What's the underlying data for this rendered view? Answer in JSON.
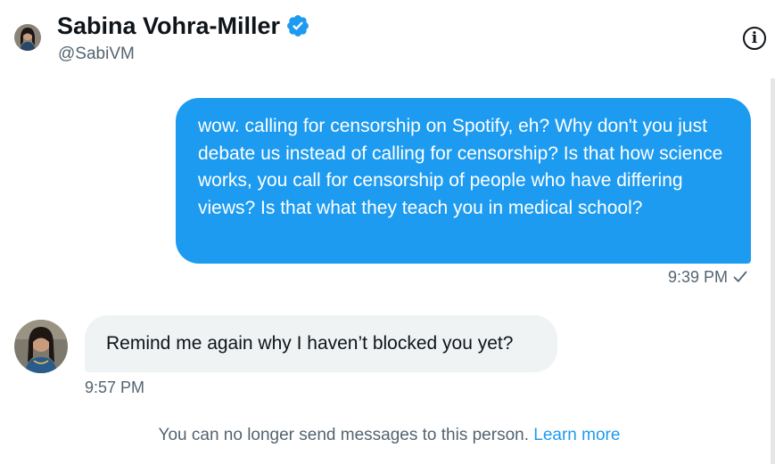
{
  "header": {
    "name": "Sabina Vohra-Miller",
    "handle": "@SabiVM",
    "verified_icon": "verified-badge-icon",
    "info_icon": "info-icon"
  },
  "messages": [
    {
      "direction": "sent",
      "text": "wow. calling for censorship on Spotify, eh? Why don't you just debate us instead of calling for censorship? Is that how science works, you call for censorship of people who have differing views? Is that what they teach you in medical school?",
      "time": "9:39 PM",
      "status_icon": "check-icon"
    },
    {
      "direction": "received",
      "text": "Remind me again why I haven’t blocked you yet?",
      "time": "9:57 PM"
    }
  ],
  "footer": {
    "notice": "You can no longer send messages to this person.",
    "link": "Learn more"
  },
  "colors": {
    "accent": "#1d9bf0",
    "received_bubble": "#eff3f4",
    "secondary_text": "#536471"
  }
}
